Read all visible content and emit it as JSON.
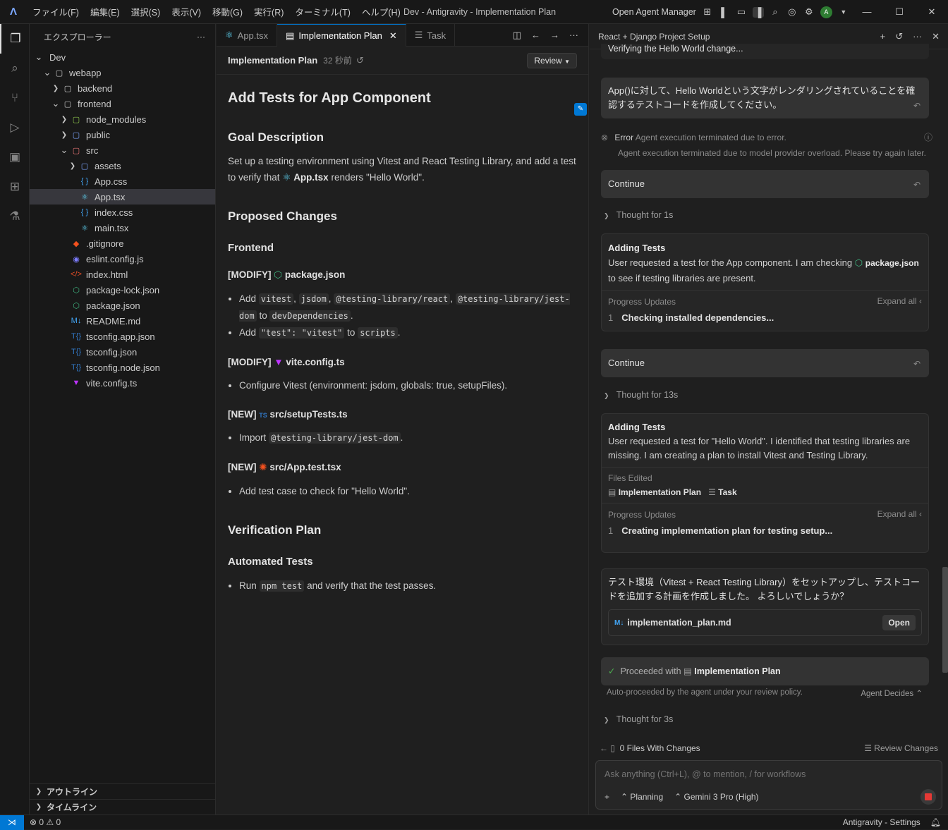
{
  "window": {
    "title": "Dev - Antigravity - Implementation Plan",
    "menu": [
      "ファイル(F)",
      "編集(E)",
      "選択(S)",
      "表示(V)",
      "移動(G)",
      "実行(R)",
      "ターミナル(T)",
      "ヘルプ(H)"
    ],
    "open_agent_manager": "Open Agent Manager",
    "avatar_letter": "A"
  },
  "explorer": {
    "title": "エクスプローラー",
    "more": "···",
    "tree": [
      {
        "label": "Dev",
        "depth": 0,
        "chev": "open",
        "icon": "",
        "icon_name": "",
        "color": ""
      },
      {
        "label": "webapp",
        "depth": 1,
        "chev": "open",
        "icon": "▢",
        "icon_name": "folder-icon",
        "color": "#c5c5c5"
      },
      {
        "label": "backend",
        "depth": 2,
        "chev": "closed",
        "icon": "▢",
        "icon_name": "folder-icon",
        "color": "#c5c5c5"
      },
      {
        "label": "frontend",
        "depth": 2,
        "chev": "open",
        "icon": "▢",
        "icon_name": "folder-icon",
        "color": "#c5c5c5"
      },
      {
        "label": "node_modules",
        "depth": 3,
        "chev": "closed",
        "icon": "▢",
        "icon_name": "folder-node-icon",
        "color": "#8bc34a"
      },
      {
        "label": "public",
        "depth": 3,
        "chev": "closed",
        "icon": "▢",
        "icon_name": "folder-public-icon",
        "color": "#7aa2f7"
      },
      {
        "label": "src",
        "depth": 3,
        "chev": "open",
        "icon": "▢",
        "icon_name": "folder-src-icon",
        "color": "#e57373"
      },
      {
        "label": "assets",
        "depth": 4,
        "chev": "closed",
        "icon": "▢",
        "icon_name": "folder-assets-icon",
        "color": "#7aa2f7"
      },
      {
        "label": "App.css",
        "depth": 4,
        "chev": "",
        "icon": "{ }",
        "icon_name": "css-file-icon",
        "color": "#42a5f5"
      },
      {
        "label": "App.tsx",
        "depth": 4,
        "chev": "",
        "icon": "⚛",
        "icon_name": "react-file-icon",
        "color": "#61dafb"
      },
      {
        "label": "index.css",
        "depth": 4,
        "chev": "",
        "icon": "{ }",
        "icon_name": "css-file-icon",
        "color": "#42a5f5"
      },
      {
        "label": "main.tsx",
        "depth": 4,
        "chev": "",
        "icon": "⚛",
        "icon_name": "react-file-icon",
        "color": "#61dafb"
      },
      {
        "label": ".gitignore",
        "depth": 3,
        "chev": "",
        "icon": "◆",
        "icon_name": "git-file-icon",
        "color": "#f4511e"
      },
      {
        "label": "eslint.config.js",
        "depth": 3,
        "chev": "",
        "icon": "◉",
        "icon_name": "eslint-file-icon",
        "color": "#7c7cff"
      },
      {
        "label": "index.html",
        "depth": 3,
        "chev": "",
        "icon": "</>",
        "icon_name": "html-file-icon",
        "color": "#e44d26"
      },
      {
        "label": "package-lock.json",
        "depth": 3,
        "chev": "",
        "icon": "⬡",
        "icon_name": "npm-file-icon",
        "color": "#3fb37f"
      },
      {
        "label": "package.json",
        "depth": 3,
        "chev": "",
        "icon": "⬡",
        "icon_name": "npm-file-icon",
        "color": "#3fb37f"
      },
      {
        "label": "README.md",
        "depth": 3,
        "chev": "",
        "icon": "M↓",
        "icon_name": "markdown-file-icon",
        "color": "#42a5f5"
      },
      {
        "label": "tsconfig.app.json",
        "depth": 3,
        "chev": "",
        "icon": "T{}",
        "icon_name": "tsconfig-file-icon",
        "color": "#3178c6"
      },
      {
        "label": "tsconfig.json",
        "depth": 3,
        "chev": "",
        "icon": "T{}",
        "icon_name": "tsconfig-file-icon",
        "color": "#3178c6"
      },
      {
        "label": "tsconfig.node.json",
        "depth": 3,
        "chev": "",
        "icon": "T{}",
        "icon_name": "tsconfig-file-icon",
        "color": "#3178c6"
      },
      {
        "label": "vite.config.ts",
        "depth": 3,
        "chev": "",
        "icon": "▼",
        "icon_name": "vite-file-icon",
        "color": "#bd34fe"
      }
    ],
    "selected": "App.tsx",
    "outline": "アウトライン",
    "timeline": "タイムライン"
  },
  "editor": {
    "tabs": [
      {
        "label": "App.tsx",
        "icon": "⚛"
      },
      {
        "label": "Implementation Plan",
        "icon": "▤"
      },
      {
        "label": "Task",
        "icon": "☰"
      }
    ],
    "active_tab": "Implementation Plan",
    "doc_title": "Implementation Plan",
    "doc_time": "32 秒前",
    "review": "Review",
    "h1": "Add Tests for App Component",
    "goal_h": "Goal Description",
    "goal_p1": "Set up a testing environment using Vitest and React Testing Library, and add a test to verify that",
    "goal_file": "App.tsx",
    "goal_p2": "renders \"Hello World\".",
    "proposed_h": "Proposed Changes",
    "frontend_h": "Frontend",
    "mod1_tag": "[MODIFY]",
    "mod1_file": "package.json",
    "mod1_b1_add": "Add",
    "mod1_b1_c1": "vitest",
    "mod1_b1_c2": "jsdom",
    "mod1_b1_c3": "@testing-library/react",
    "mod1_b1_c4": "@testing-library/jest-dom",
    "mod1_b1_to": "to",
    "mod1_b1_c5": "devDependencies",
    "mod1_b2_add": "Add",
    "mod1_b2_c1": "\"test\": \"vitest\"",
    "mod1_b2_to": "to",
    "mod1_b2_c2": "scripts",
    "mod2_tag": "[MODIFY]",
    "mod2_file": "vite.config.ts",
    "mod2_b1": "Configure Vitest (environment: jsdom, globals: true, setupFiles).",
    "new1_tag": "[NEW]",
    "new1_file": "src/setupTests.ts",
    "new1_b1_import": "Import",
    "new1_b1_code": "@testing-library/jest-dom",
    "new2_tag": "[NEW]",
    "new2_file": "src/App.test.tsx",
    "new2_b1": "Add test case to check for \"Hello World\".",
    "verif_h": "Verification Plan",
    "auto_h": "Automated Tests",
    "run": "Run",
    "run_code": "npm test",
    "run_rest": "and verify that the test passes."
  },
  "agent": {
    "title": "React + Django Project Setup",
    "cut_text": "Verifying the Hello World change...",
    "user_msg": "App()に対して、Hello Worldという文字がレンダリングされていることを確認するテストコードを作成してください。",
    "error_label": "Error",
    "error_short": "Agent execution terminated due to error.",
    "error_long": "Agent execution terminated due to model provider overload. Please try again later.",
    "continue1": "Continue",
    "thought1": "Thought for 1s",
    "card1_title": "Adding Tests",
    "card1_text1": "User requested a test for the App component. I am checking",
    "card1_file": "package.json",
    "card1_text2": "to see if testing libraries are present.",
    "progress_label": "Progress Updates",
    "expand_all": "Expand all",
    "card1_step_n": "1",
    "card1_step": "Checking installed dependencies...",
    "continue2": "Continue",
    "thought2": "Thought for 13s",
    "card2_title": "Adding Tests",
    "card2_text": "User requested a test for \"Hello World\". I identified that testing libraries are missing. I am creating a plan to install Vitest and Testing Library.",
    "files_edited": "Files Edited",
    "file_a": "Implementation Plan",
    "file_b": "Task",
    "progress_label2": "Progress Updates",
    "expand_all2": "Expand all",
    "card2_step_n": "1",
    "card2_step": "Creating implementation plan for testing setup...",
    "agent_msg": "テスト環境（Vitest + React Testing Library）をセットアップし、テストコードを追加する計画を作成しました。 よろしいでしょうか？",
    "plan_file": "implementation_plan.md",
    "open": "Open",
    "proceeded": "Proceeded with",
    "proceeded_file": "Implementation Plan",
    "auto_proceeded": "Auto-proceeded by the agent under your review policy.",
    "agent_decides": "Agent Decides",
    "thought3": "Thought for 3s",
    "files_changes": "0 Files With Changes",
    "review_changes": "Review Changes",
    "placeholder": "Ask anything (Ctrl+L), @ to mention, / for workflows",
    "planning": "Planning",
    "model": "Gemini 3 Pro (High)"
  },
  "status": {
    "errors": "0",
    "warnings": "0",
    "right": "Antigravity - Settings"
  }
}
